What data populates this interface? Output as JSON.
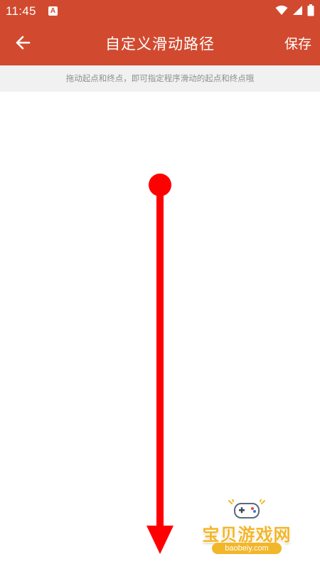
{
  "status_bar": {
    "time": "11:45",
    "app_icon_letter": "A",
    "icons": [
      "wifi-icon",
      "cell-signal-icon",
      "battery-icon"
    ]
  },
  "app_bar": {
    "back_icon": "arrow-left-icon",
    "title": "自定义滑动路径",
    "save_label": "保存"
  },
  "hint": {
    "text": "拖动起点和终点，即可指定程序滑动的起点和终点哦"
  },
  "swipe_path": {
    "start_marker": "circle",
    "end_marker": "arrowhead",
    "direction": "down",
    "color": "#ff0000"
  },
  "watermark": {
    "text": "宝贝游戏网",
    "url": "baobeiy.com",
    "icon": "gamepad-icon"
  },
  "colors": {
    "primary": "#d14a2f",
    "hint_background": "#f1f1f1",
    "hint_text": "#8f8f8f",
    "path": "#ff0000",
    "watermark": "#f2b62a"
  }
}
